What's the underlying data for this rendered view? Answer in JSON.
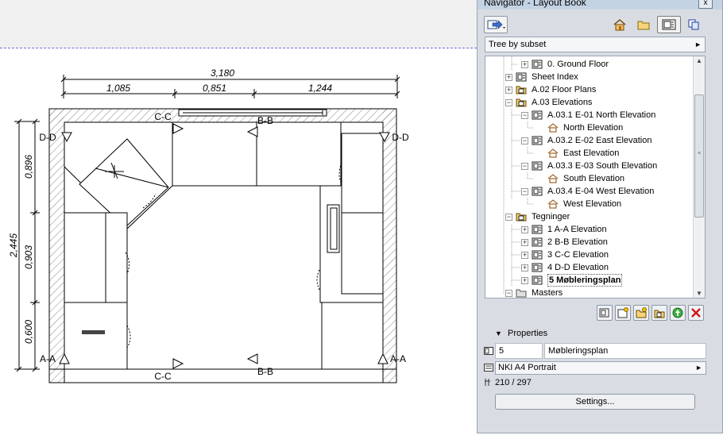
{
  "navigator": {
    "title": "Navigator - Layout Book",
    "close_label": "x",
    "subset_select": "Tree by subset",
    "tree_items": [
      {
        "label": "0. Ground Floor",
        "icon": "layout-icon"
      },
      {
        "label": "Sheet Index",
        "icon": "layout-icon"
      },
      {
        "label": "A.02 Floor Plans",
        "icon": "subset-folder-icon"
      },
      {
        "label": "A.03 Elevations",
        "icon": "subset-folder-icon"
      },
      {
        "label": "A.03.1 E-01 North Elevation",
        "icon": "layout-icon"
      },
      {
        "label": "North Elevation",
        "icon": "elevation-drawing-icon"
      },
      {
        "label": "A.03.2 E-02 East Elevation",
        "icon": "layout-icon"
      },
      {
        "label": "East Elevation",
        "icon": "elevation-drawing-icon"
      },
      {
        "label": "A.03.3 E-03 South Elevation",
        "icon": "layout-icon"
      },
      {
        "label": "South Elevation",
        "icon": "elevation-drawing-icon"
      },
      {
        "label": "A.03.4 E-04 West Elevation",
        "icon": "layout-icon"
      },
      {
        "label": "West Elevation",
        "icon": "elevation-drawing-icon"
      },
      {
        "label": "Tegninger",
        "icon": "subset-folder-icon"
      },
      {
        "label": "1 A-A Elevation",
        "icon": "layout-icon"
      },
      {
        "label": "2 B-B Elevation",
        "icon": "layout-icon"
      },
      {
        "label": "3 C-C Elevation",
        "icon": "layout-icon"
      },
      {
        "label": "4 D-D Elevation",
        "icon": "layout-icon"
      },
      {
        "label": "5 Møbleringsplan",
        "icon": "layout-icon",
        "selected": true
      },
      {
        "label": "Masters",
        "icon": "master-folder-icon"
      }
    ],
    "properties": {
      "header": "Properties",
      "id_value": "5",
      "name_value": "Møbleringsplan",
      "master_select": "NKI A4 Portrait",
      "size_text": "210 / 297",
      "settings_label": "Settings..."
    }
  },
  "drawing": {
    "dim_overall_width": "3,180",
    "dim_seg_1": "1,085",
    "dim_seg_2": "0,851",
    "dim_seg_3": "1,244",
    "dim_overall_depth": "2,445",
    "dim_left_1": "0,896",
    "dim_left_2": "0,903",
    "dim_left_3": "0,600",
    "marker_cc_top": "C-C",
    "marker_bb_top": "B-B",
    "marker_dd_left": "D-D",
    "marker_dd_right": "D-D",
    "marker_aa_left": "A-A",
    "marker_aa_right": "A-A",
    "marker_cc_bottom": "C-C",
    "marker_bb_bottom": "B-B"
  }
}
